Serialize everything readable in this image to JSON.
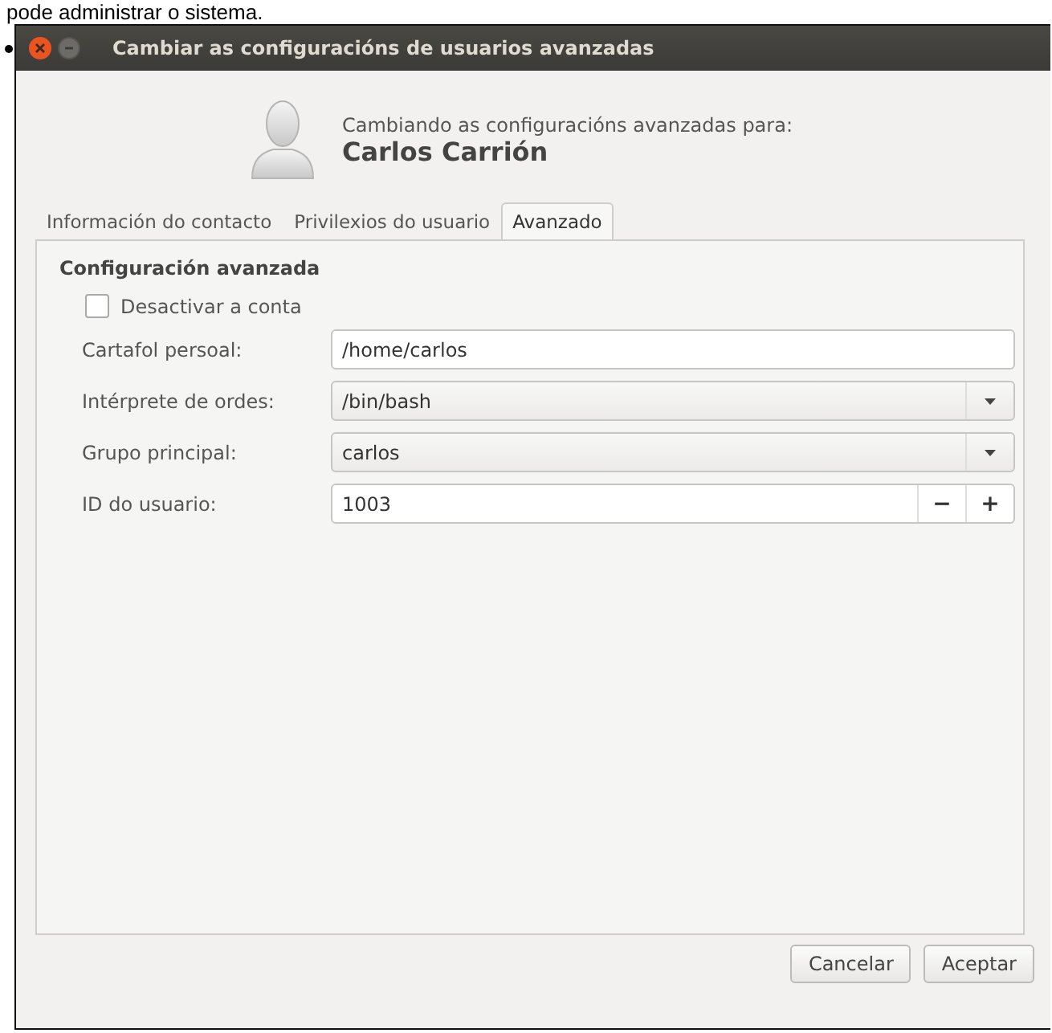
{
  "page_text": "pode administrar o sistema.",
  "window": {
    "title": "Cambiar as configuracións de usuarios avanzadas"
  },
  "header": {
    "caption": "Cambiando as configuracións avanzadas para:",
    "user_name": "Carlos Carrión"
  },
  "tabs": [
    {
      "label": "Información do contacto",
      "selected": false
    },
    {
      "label": "Privilexios do usuario",
      "selected": false
    },
    {
      "label": "Avanzado",
      "selected": true
    }
  ],
  "section_title": "Configuración avanzada",
  "disable_account": {
    "label": "Desactivar a conta",
    "checked": false
  },
  "fields": [
    {
      "kind": "entry",
      "label": "Cartafol persoal:",
      "value": "/home/carlos"
    },
    {
      "kind": "combo",
      "label": "Intérprete de ordes:",
      "value": "/bin/bash"
    },
    {
      "kind": "combo",
      "label": "Grupo principal:",
      "value": "carlos"
    },
    {
      "kind": "spin",
      "label": "ID do usuario:",
      "value": "1003",
      "minus": "−",
      "plus": "+"
    }
  ],
  "buttons": [
    "Cancelar",
    "Aceptar"
  ]
}
